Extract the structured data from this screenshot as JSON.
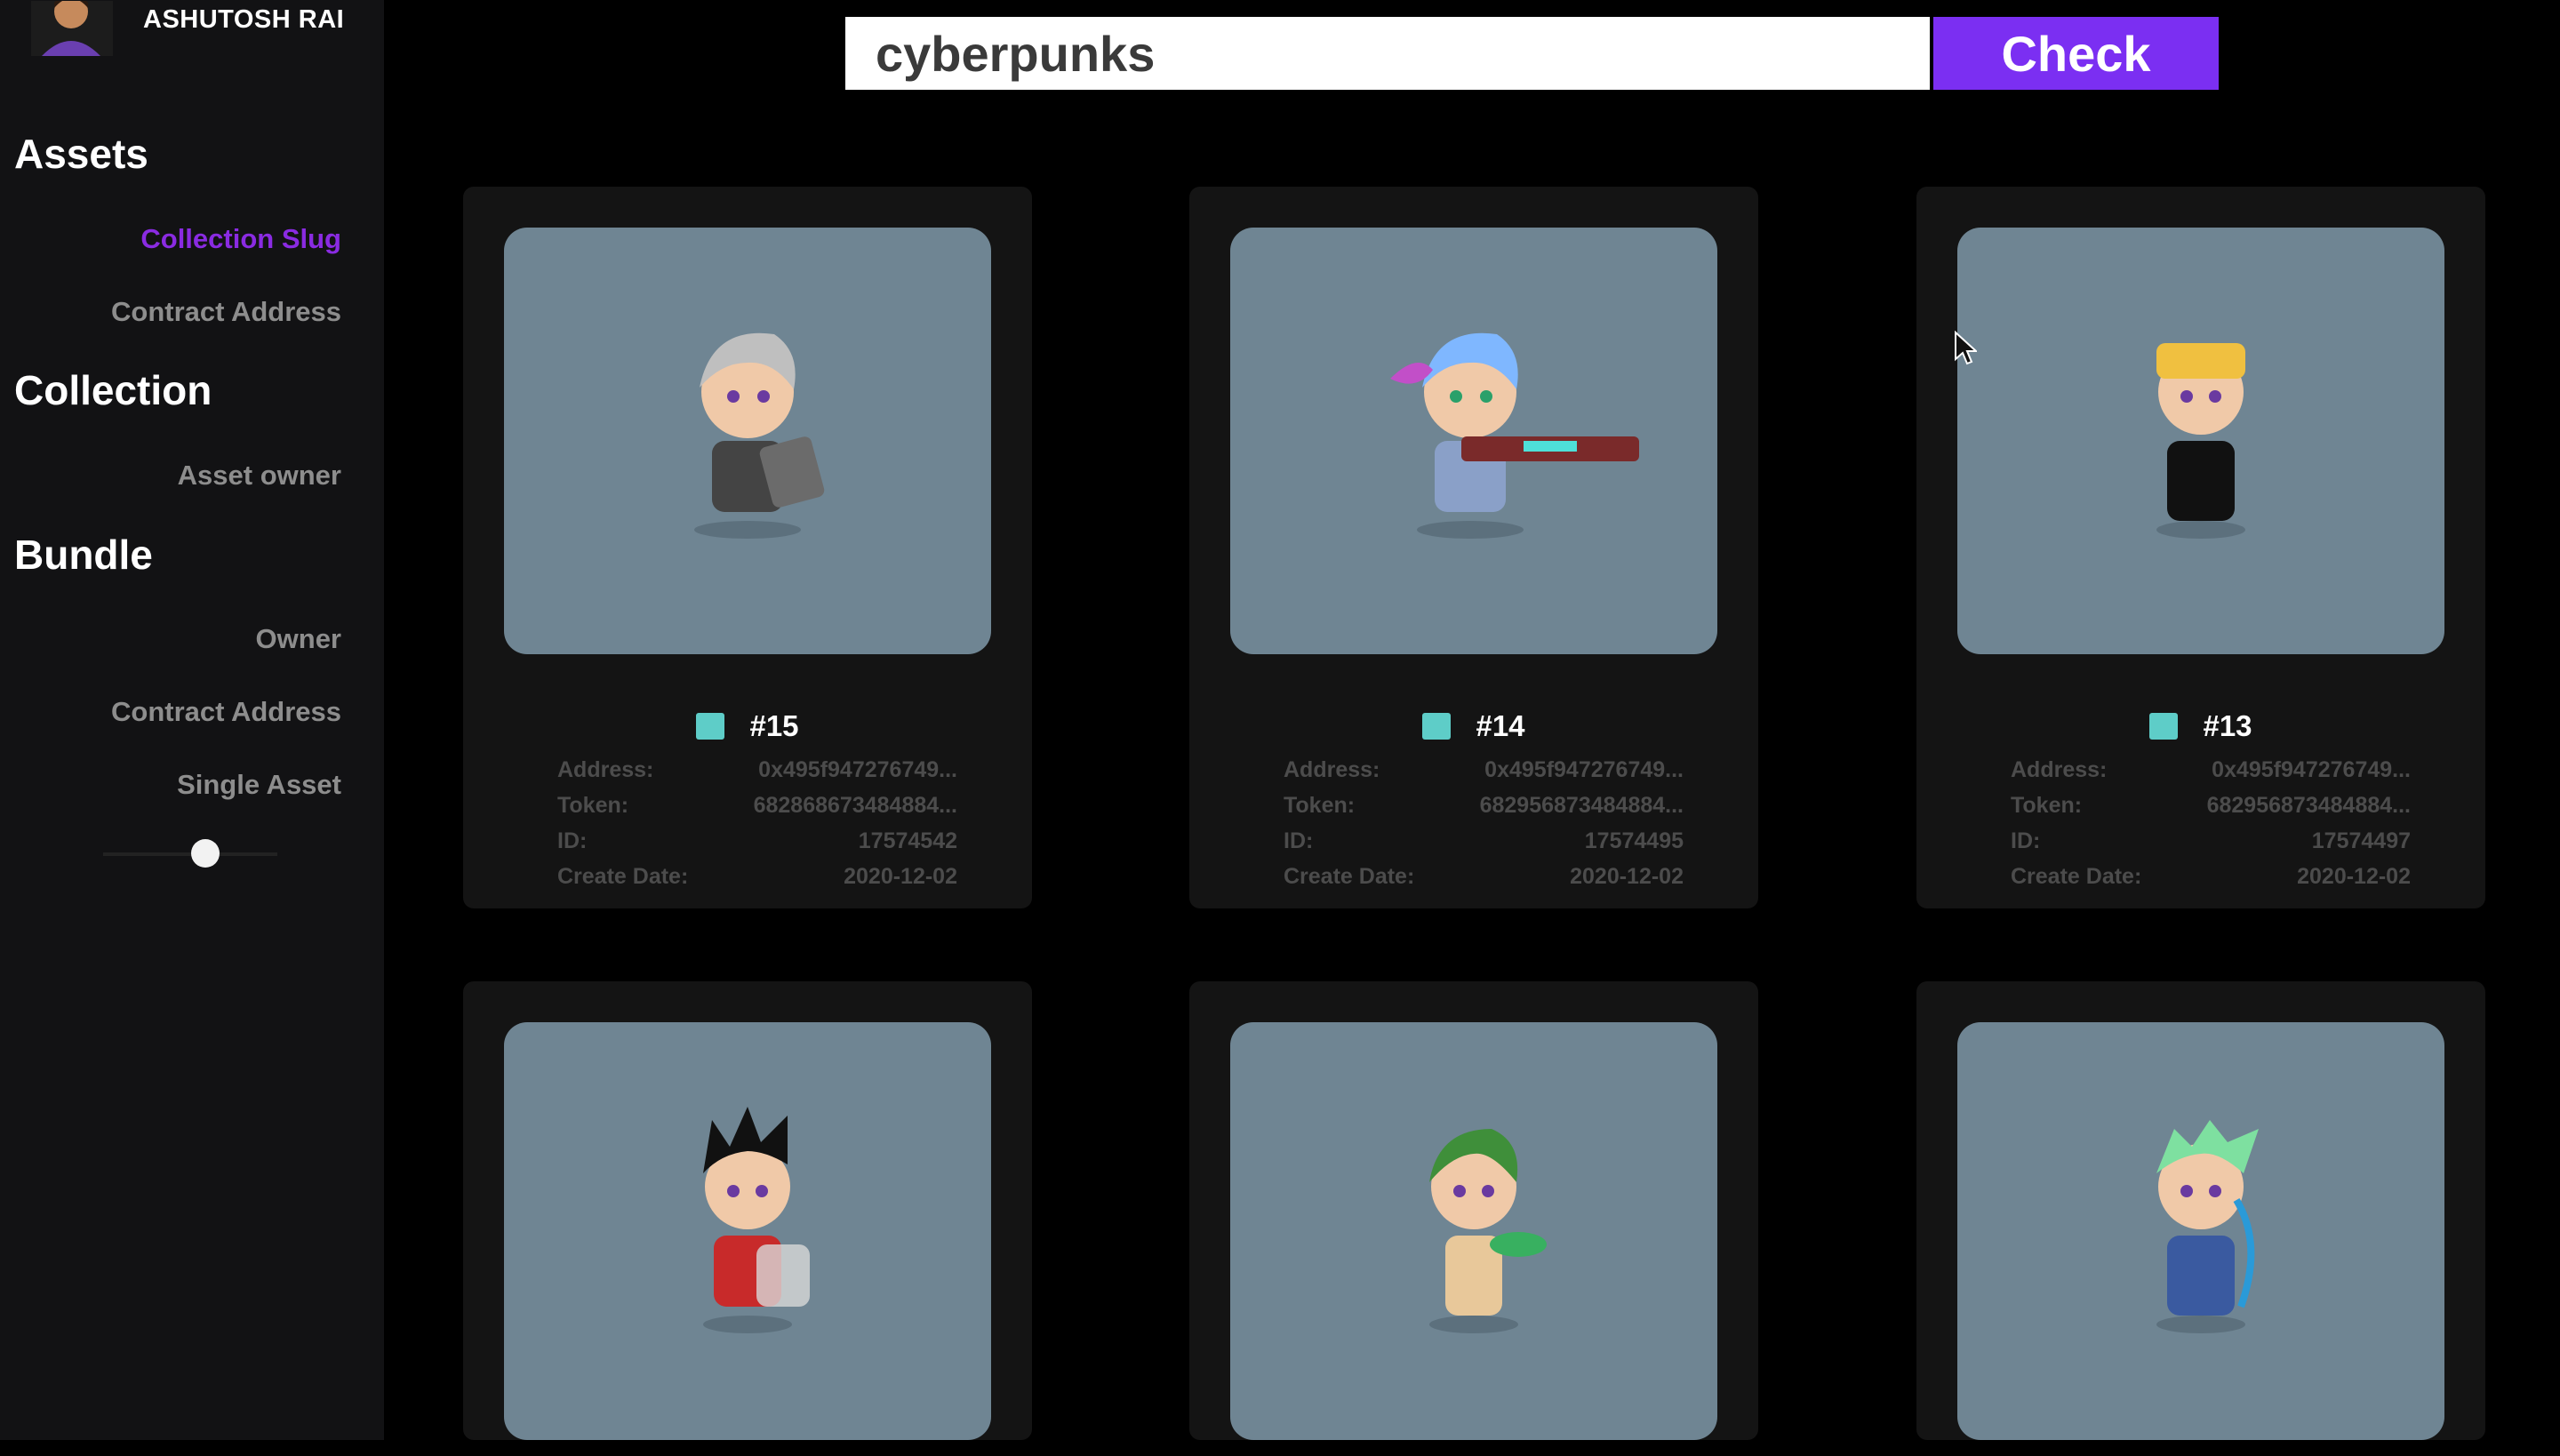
{
  "profile": {
    "name": "ASHUTOSH RAI"
  },
  "sidebar": {
    "sections": [
      {
        "heading": "Assets",
        "items": [
          "Collection Slug",
          "Contract Address"
        ]
      },
      {
        "heading": "Collection",
        "items": [
          "Asset owner"
        ]
      },
      {
        "heading": "Bundle",
        "items": [
          "Owner",
          "Contract Address",
          "Single Asset"
        ]
      }
    ],
    "active_item": "Collection Slug"
  },
  "search": {
    "value": "cyberpunks",
    "button_label": "Check"
  },
  "meta_labels": {
    "address": "Address:",
    "token": "Token:",
    "id": "ID:",
    "create_date": "Create Date:"
  },
  "cards": [
    {
      "title": "#15",
      "address": "0x495f947276749...",
      "token": "6828686734848​84...",
      "id": "17574542",
      "create_date": "2020-12-02",
      "hair": "#bfbfbf"
    },
    {
      "title": "#14",
      "address": "0x495f947276749...",
      "token": "6829568734848​84...",
      "id": "17574495",
      "create_date": "2020-12-02",
      "hair": "#7fb7ff"
    },
    {
      "title": "#13",
      "address": "0x495f947276749...",
      "token": "6829568734848​84...",
      "id": "17574497",
      "create_date": "2020-12-02",
      "hair": "#f0c040"
    },
    {
      "hair": "#111111"
    },
    {
      "hair": "#3f8f3a"
    },
    {
      "hair": "#7ee0a0"
    }
  ],
  "colors": {
    "accent": "#7b2ff2",
    "active_link": "#8a2be2",
    "card_image_bg": "#6f8593",
    "swatch": "#5ecdc8"
  }
}
